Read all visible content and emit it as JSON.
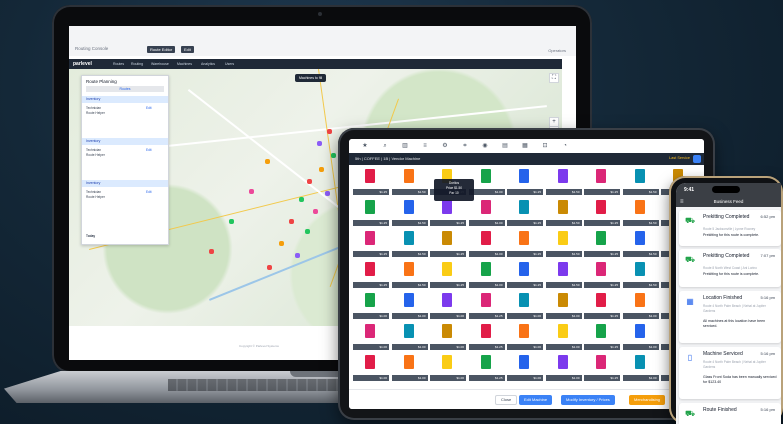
{
  "laptop": {
    "browser": {
      "breadcrumb": "Routing Console",
      "buttons": [
        "Route Editor",
        "Edit"
      ],
      "account": "Operators"
    },
    "app": {
      "logo": "parlevel",
      "nav": [
        "Routes",
        "Routing",
        "Warehouse",
        "Machines",
        "Analytics",
        "Users"
      ],
      "map_tooltip": "Machines to fill",
      "zoom_in": "+",
      "zoom_out": "−",
      "route_panel": {
        "title": "Route Planning",
        "tab": "Routes",
        "sections": [
          {
            "title": "Inventory",
            "lines": [
              "Technician",
              "Route Helper"
            ],
            "link": "Edit"
          },
          {
            "title": "Inventory",
            "lines": [
              "Technician",
              "Route Helper"
            ],
            "link": "Edit"
          },
          {
            "title": "Inventory",
            "lines": [
              "Technician",
              "Route Helper"
            ],
            "link": "Edit"
          }
        ],
        "footer": "Today"
      },
      "copyright": "Copyright © Parlevel Systems"
    }
  },
  "tablet": {
    "toolbar_icons": [
      "home-icon",
      "search-icon",
      "chart-icon",
      "list-icon",
      "settings-icon",
      "tag-icon",
      "camera-icon",
      "print-icon",
      "grid-icon",
      "lock-icon",
      "bell-icon"
    ],
    "header": "5th | COFFEE | 1B | Vendor Machine",
    "header_right": "Last Service",
    "popup": {
      "line1": "Doritos",
      "line2": "Price $1.50",
      "line3": "Par 10"
    },
    "slots": [
      [
        "$1.25",
        "$1.50",
        "$1.25",
        "$1.00",
        "$1.25",
        "$1.50",
        "$1.25",
        "$1.50",
        "$1.25"
      ],
      [
        "$1.25",
        "$1.50",
        "$1.25",
        "$1.00",
        "$1.25",
        "$1.50",
        "$1.25",
        "$1.50",
        "$1.25"
      ],
      [
        "$1.25",
        "$1.50",
        "$1.25",
        "$1.00",
        "$1.25",
        "$1.50",
        "$1.25",
        "$1.50",
        "$1.25"
      ],
      [
        "$1.25",
        "$1.50",
        "$1.25",
        "$1.00",
        "$1.25",
        "$1.50",
        "$1.25",
        "$1.50",
        "$1.25"
      ],
      [
        "$1.00",
        "$1.00",
        "$1.00",
        "$1.25",
        "$1.00",
        "$1.00",
        "$1.25",
        "$1.00",
        "$1.00"
      ],
      [
        "$1.00",
        "$1.00",
        "$1.00",
        "$1.25",
        "$1.00",
        "$1.00",
        "$1.25",
        "$1.00",
        "$1.00"
      ],
      [
        "$1.00",
        "$1.00",
        "$1.00",
        "$1.25",
        "$1.00",
        "$1.00",
        "$1.25",
        "$1.00",
        "$1.00"
      ]
    ],
    "buttons": {
      "close": "Close",
      "edit": "Edit Machine",
      "modify": "Modify Inventory / Prices",
      "merch": "Merchandising"
    }
  },
  "phone": {
    "time": "9:41",
    "title": "Business Feed",
    "feed": [
      {
        "title": "Prekitting Completed",
        "time": "6:52 pm",
        "sub": "Route 5 Jacksonville | Lynne Rooney",
        "body": "Prekitting for this route is complete.",
        "icon": "truck-icon"
      },
      {
        "title": "Prekitting Completed",
        "time": "7:07 pm",
        "sub": "Route 8 North West Coast | Ani Lorino",
        "body": "Prekitting for this route is complete.",
        "icon": "truck-icon"
      },
      {
        "title": "Location Finished",
        "time": "5:16 pm",
        "sub": "Route 4 North Palm Beach | Nehal at Jupiter Gardens",
        "body": "All machines at this location have been serviced.",
        "icon": "building-icon"
      },
      {
        "title": "Machine Serviced",
        "time": "5:16 pm",
        "sub": "Route 4 North Palm Beach | Nehal at Jupiter Gardens",
        "body": "Glass Front Soda has been manually serviced for $123.40",
        "icon": "machine-icon"
      },
      {
        "title": "Route Finished",
        "time": "5:16 pm",
        "sub": "",
        "body": "",
        "icon": "truck-icon"
      }
    ]
  },
  "colors": {
    "background": "#142838",
    "nav": "#1f2937",
    "accent_blue": "#3b82f6",
    "accent_orange": "#f59e0b",
    "feed_green": "#22a34a",
    "feed_blue": "#2563eb"
  }
}
